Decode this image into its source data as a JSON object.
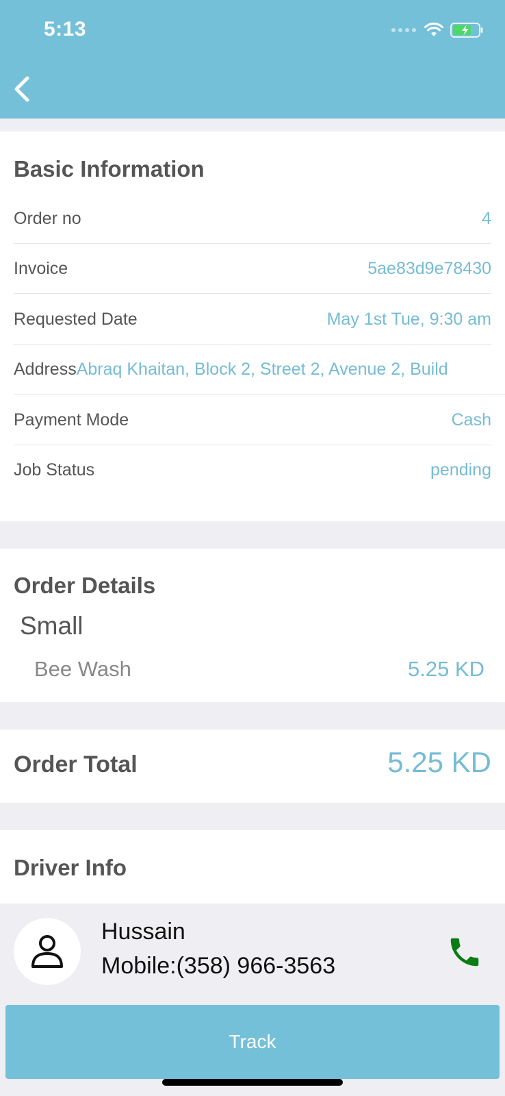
{
  "status_bar": {
    "time": "5:13"
  },
  "basic_info": {
    "title": "Basic Information",
    "rows": [
      {
        "label": "Order no",
        "value": "4"
      },
      {
        "label": "Invoice",
        "value": "5ae83d9e78430"
      },
      {
        "label": "Requested Date",
        "value": "May 1st Tue, 9:30 am"
      },
      {
        "label": "Address",
        "value": "Abraq Khaitan, Block 2,  Street 2, Avenue 2, Build"
      },
      {
        "label": "Payment Mode",
        "value": "Cash"
      },
      {
        "label": "Job Status",
        "value": "pending"
      }
    ]
  },
  "order_details": {
    "title": "Order Details",
    "size": "Small",
    "item": {
      "name": "Bee Wash",
      "price": "5.25 KD"
    }
  },
  "order_total": {
    "label": "Order Total",
    "value": "5.25 KD"
  },
  "driver_info": {
    "title": "Driver Info",
    "name": "Hussain",
    "mobile": "Mobile:(358) 966-3563"
  },
  "track_button": {
    "label": "Track"
  },
  "colors": {
    "header": "#75c0d9",
    "accent": "#75bcd5",
    "phone": "#0a7d12"
  }
}
